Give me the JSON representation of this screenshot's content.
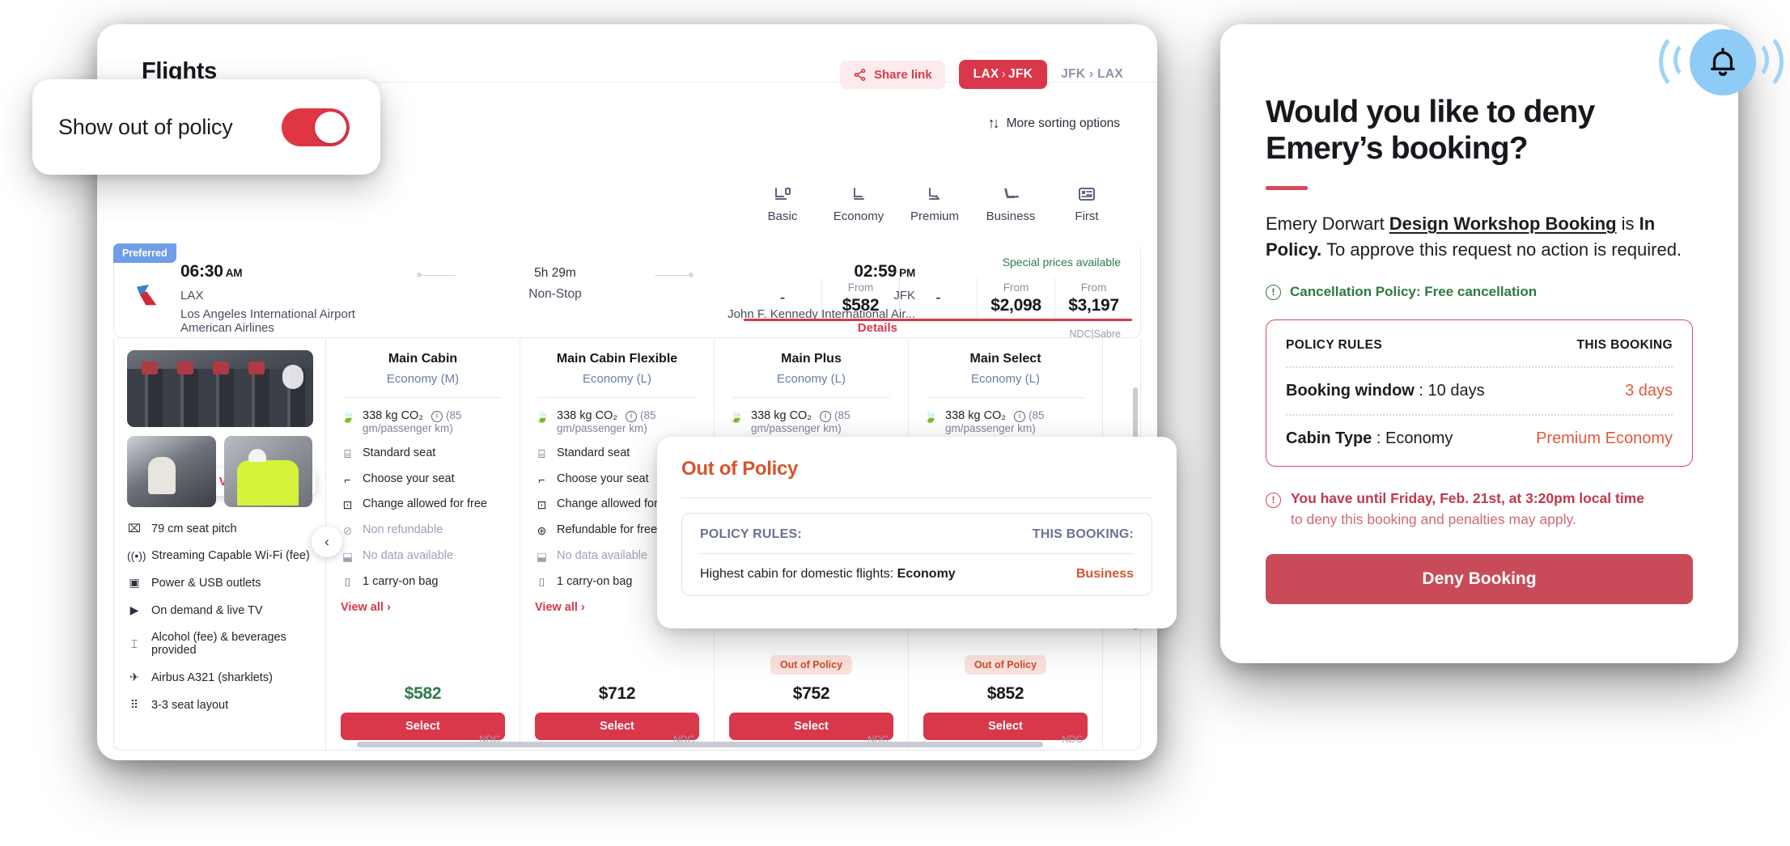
{
  "app": {
    "title": "Flights",
    "share_label": "Share link",
    "route_from": "LAX",
    "route_chev": "›",
    "route_to": "JFK",
    "route_alt": "JFK › LAX",
    "sort_label": "More sorting options",
    "sort_icon": "↑↓"
  },
  "toggle": {
    "label": "Show out of policy",
    "state": "on"
  },
  "cabin_tabs": [
    {
      "label": "Basic",
      "icon": "seat-basic-icon"
    },
    {
      "label": "Economy",
      "icon": "seat-economy-icon"
    },
    {
      "label": "Premium",
      "icon": "seat-premium-icon"
    },
    {
      "label": "Business",
      "icon": "seat-business-icon"
    },
    {
      "label": "First",
      "icon": "seat-first-icon"
    }
  ],
  "flight": {
    "badge": "Preferred",
    "depart_time": "06:30",
    "depart_meridiem": "AM",
    "depart_code": "LAX",
    "depart_airport": "Los Angeles International Airport",
    "carrier": "American Airlines",
    "duration": "5h 29m",
    "stops": "Non-Stop",
    "arrive_time": "02:59",
    "arrive_meridiem": "PM",
    "arrive_code": "JFK",
    "arrive_airport": "John F. Kennedy International Air...",
    "details_label": "Details",
    "special_prices": "Special prices available",
    "source": "NDC|Sabre",
    "price_columns": [
      {
        "from_label": "",
        "value": "-"
      },
      {
        "from_label": "From",
        "value": "$582"
      },
      {
        "from_label": "",
        "value": "-"
      },
      {
        "from_label": "From",
        "value": "$2,098"
      },
      {
        "from_label": "From",
        "value": "$3,197"
      }
    ]
  },
  "photos": {
    "view_all_label": "View all photos"
  },
  "amenities": [
    {
      "icon": "seat-pitch-icon",
      "glyph": "⌧",
      "text": "79 cm seat pitch"
    },
    {
      "icon": "wifi-icon",
      "glyph": "((•))",
      "text": "Streaming Capable Wi-Fi (fee)"
    },
    {
      "icon": "power-outlet-icon",
      "glyph": "▣",
      "text": "Power & USB outlets"
    },
    {
      "icon": "tv-icon",
      "glyph": "▶",
      "text": "On demand & live TV"
    },
    {
      "icon": "beverage-icon",
      "glyph": "⌶",
      "text": "Alcohol (fee) & beverages provided"
    },
    {
      "icon": "aircraft-icon",
      "glyph": "✈",
      "text": "Airbus A321 (sharklets)"
    },
    {
      "icon": "seat-layout-icon",
      "glyph": "⠿",
      "text": "3-3 seat layout"
    }
  ],
  "fare_columns": [
    {
      "title": "Main Cabin",
      "subtitle": "Economy (M)",
      "co2": "338 kg CO₂",
      "co2_sub": "(85 gm/passenger km)",
      "features": [
        {
          "glyph": "⌸",
          "text": "Standard seat",
          "muted": false
        },
        {
          "glyph": "⌐",
          "text": "Choose your seat",
          "muted": false
        },
        {
          "glyph": "⊡",
          "text": "Change allowed for free",
          "muted": false
        },
        {
          "glyph": "⊘",
          "text": "Non refundable",
          "muted": true
        },
        {
          "glyph": "⬓",
          "text": "No data available",
          "muted": true
        },
        {
          "glyph": "⌷",
          "text": "1 carry-on bag",
          "muted": false
        }
      ],
      "view_all": "View all ›",
      "out_of_policy": null,
      "price": "$582",
      "price_green": true,
      "select_label": "Select",
      "ndc": "NDC"
    },
    {
      "title": "Main Cabin Flexible",
      "subtitle": "Economy (L)",
      "co2": "338 kg CO₂",
      "co2_sub": "(85 gm/passenger km)",
      "features": [
        {
          "glyph": "⌸",
          "text": "Standard seat",
          "muted": false
        },
        {
          "glyph": "⌐",
          "text": "Choose your seat",
          "muted": false
        },
        {
          "glyph": "⊡",
          "text": "Change allowed for free",
          "muted": false
        },
        {
          "glyph": "⊛",
          "text": "Refundable for free",
          "muted": false
        },
        {
          "glyph": "⬓",
          "text": "No data available",
          "muted": true
        },
        {
          "glyph": "⌷",
          "text": "1 carry-on bag",
          "muted": false
        }
      ],
      "view_all": "View all ›",
      "out_of_policy": null,
      "price": "$712",
      "price_green": false,
      "select_label": "Select",
      "ndc": "NDC"
    },
    {
      "title": "Main Plus",
      "subtitle": "Economy (L)",
      "co2": "338 kg CO₂",
      "co2_sub": "(85 gm/passenger km)",
      "features": [],
      "view_all": "",
      "out_of_policy": "Out of Policy",
      "price": "$752",
      "price_green": false,
      "select_label": "Select",
      "ndc": "NDC"
    },
    {
      "title": "Main Select",
      "subtitle": "Economy (L)",
      "co2": "338 kg CO₂",
      "co2_sub": "(85 gm/passenger km)",
      "features": [],
      "view_all": "",
      "out_of_policy": "Out of Policy",
      "price": "$852",
      "price_green": false,
      "select_label": "Select",
      "ndc": "NDC"
    }
  ],
  "oop_popup": {
    "title": "Out of Policy",
    "head_rules": "POLICY RULES:",
    "head_booking": "THIS BOOKING:",
    "rule_prefix": "Highest cabin for domestic flights: ",
    "rule_value": "Economy",
    "booking_value": "Business"
  },
  "deny": {
    "title_line1": "Would you like to deny",
    "title_line2": "Emery’s booking?",
    "body_name": "Emery Dorwart ",
    "body_link": "Design Workshop Booking",
    "body_mid": " is ",
    "body_status": "In Policy.",
    "body_tail": " To approve this request no action is required.",
    "cancellation": "Cancellation Policy: Free cancellation",
    "policy_head_rules": "POLICY RULES",
    "policy_head_booking": "THIS BOOKING",
    "rows": [
      {
        "label": "Booking window",
        "sep": " : ",
        "rule": "10 days",
        "booking": "3 days"
      },
      {
        "label": "Cabin Type",
        "sep": " : ",
        "rule": "Economy",
        "booking": "Premium Economy"
      }
    ],
    "warn_bold": "You have until Friday, Feb. 21st, at 3:20pm local time",
    "warn_normal": "to deny this booking and penalties may apply.",
    "button": "Deny Booking"
  },
  "colors": {
    "brand_red": "#d9374a",
    "accent_orange": "#d8542c",
    "policy_red": "#e05a3c",
    "green": "#2d7a4c",
    "preferred_blue": "#6f9ee8",
    "bell_blue": "#8ecbf5"
  }
}
